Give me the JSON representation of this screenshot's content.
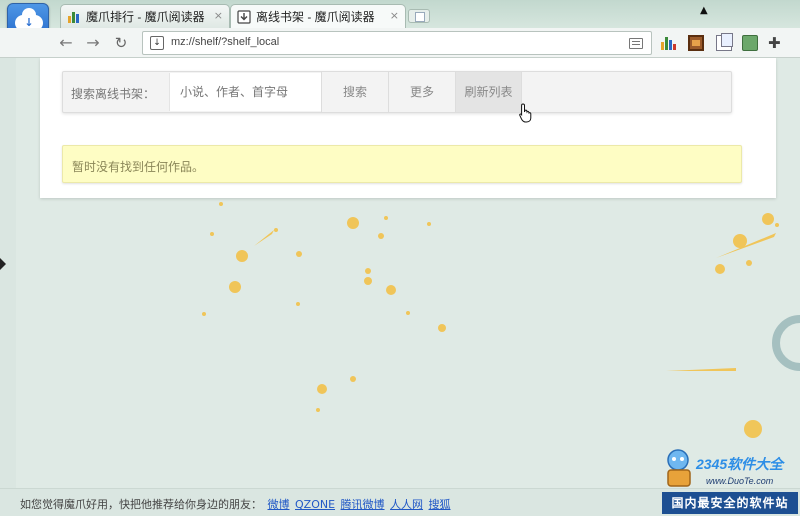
{
  "browser": {
    "tabs": [
      {
        "title": "魔爪排行 - 魔爪阅读器",
        "close": "×"
      },
      {
        "title": "离线书架 - 魔爪阅读器",
        "close": "×"
      }
    ],
    "address": "mz://shelf/?shelf_local"
  },
  "toolbar": {
    "back": "←",
    "forward": "→",
    "reload": "↻",
    "wrench": "🔧"
  },
  "shelf": {
    "search_label": "搜索离线书架：",
    "search_placeholder": "小说、作者、首字母",
    "search_button": "搜索",
    "more_button": "更多",
    "refresh_button": "刷新列表",
    "empty_notice": "暂时没有找到任何作品。"
  },
  "footer": {
    "prompt": "如您觉得魔爪好用，快把他推荐给你身边的朋友：",
    "links": [
      "微博",
      "QZONE",
      "腾讯微博",
      "人人网",
      "搜狐"
    ]
  },
  "watermark": {
    "brand": "2345软件大全",
    "url": "www.DuoTe.com",
    "slogan": "国内最安全的软件站"
  },
  "colors": {
    "notice_bg": "#fefdc4",
    "link": "#2158c6",
    "splash": "#f2c24a"
  }
}
